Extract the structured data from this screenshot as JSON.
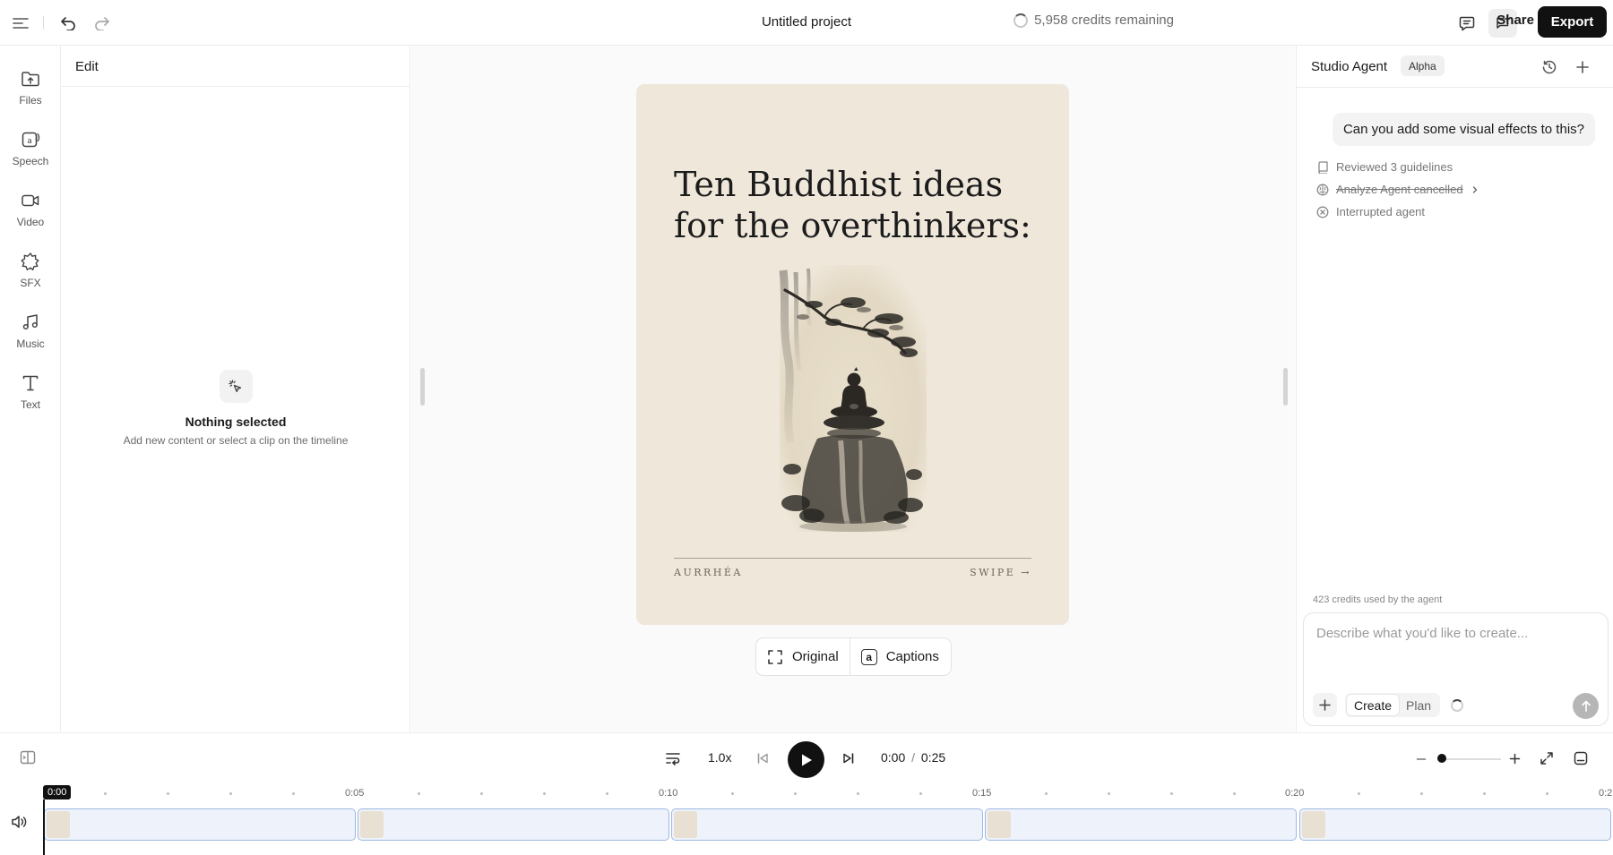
{
  "topbar": {
    "project_title": "Untitled project",
    "credits_label": "5,958 credits remaining",
    "share_label": "Share",
    "export_label": "Export"
  },
  "rail": {
    "items": [
      {
        "label": "Files",
        "icon": "folder-upload-icon"
      },
      {
        "label": "Speech",
        "icon": "speech-icon"
      },
      {
        "label": "Video",
        "icon": "video-camera-icon"
      },
      {
        "label": "SFX",
        "icon": "sfx-burst-icon"
      },
      {
        "label": "Music",
        "icon": "music-note-icon"
      },
      {
        "label": "Text",
        "icon": "text-t-icon"
      }
    ]
  },
  "edit_panel": {
    "title": "Edit",
    "empty_title": "Nothing selected",
    "empty_subtitle": "Add new content or select a clip on the timeline"
  },
  "canvas": {
    "title_line1": "Ten Buddhist ideas",
    "title_line2": "for the overthinkers:",
    "brand": "AURRHÉA",
    "swipe": "SWIPE →",
    "view_original": "Original",
    "view_captions": "Captions",
    "captions_glyph": "a"
  },
  "agent": {
    "title": "Studio Agent",
    "badge": "Alpha",
    "user_message": "Can you add some visual effects to this?",
    "steps": [
      {
        "text": "Reviewed 3 guidelines",
        "icon": "book-icon",
        "struck": false
      },
      {
        "text": "Analyze Agent cancelled",
        "icon": "brain-icon",
        "struck": true
      },
      {
        "text": "Interrupted agent",
        "icon": "x-circle-icon",
        "struck": false
      }
    ],
    "credits_used": "423 credits used by the agent",
    "input_placeholder": "Describe what you'd like to create...",
    "mode_create": "Create",
    "mode_plan": "Plan"
  },
  "transport": {
    "speed": "1.0x",
    "current_time": "0:00",
    "separator": "/",
    "total_time": "0:25"
  },
  "timeline": {
    "playhead_label": "0:00",
    "ticks": [
      "0:05",
      "0:10",
      "0:15",
      "0:20",
      "0:2"
    ]
  }
}
